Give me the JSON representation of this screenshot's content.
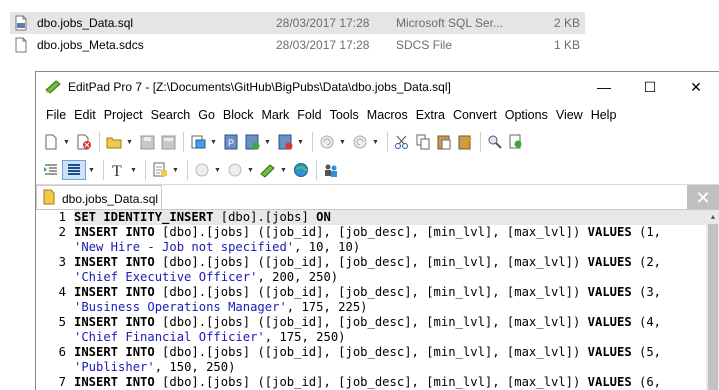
{
  "explorer": {
    "files": [
      {
        "name": "dbo.jobs_Data.sql",
        "date": "28/03/2017 17:28",
        "type": "Microsoft SQL Ser...",
        "size": "2 KB",
        "icon": "sql-file-icon",
        "selected": true
      },
      {
        "name": "dbo.jobs_Meta.sdcs",
        "date": "28/03/2017 17:28",
        "type": "SDCS File",
        "size": "1 KB",
        "icon": "generic-file-icon",
        "selected": false
      }
    ]
  },
  "window": {
    "title": "EditPad Pro 7 - [Z:\\Documents\\GitHub\\BigPubs\\Data\\dbo.jobs_Data.sql]",
    "controls": {
      "minimize": "—",
      "maximize": "☐",
      "close": "✕"
    }
  },
  "menu": [
    "File",
    "Edit",
    "Project",
    "Search",
    "Go",
    "Block",
    "Mark",
    "Fold",
    "Tools",
    "Macros",
    "Extra",
    "Convert",
    "Options",
    "View",
    "Help"
  ],
  "tab": {
    "label": "dbo.jobs_Data.sql",
    "close": "✕"
  },
  "editor": {
    "lines": [
      {
        "n": "1",
        "current": true,
        "parts": [
          [
            "kw",
            "SET IDENTITY_INSERT"
          ],
          [
            "t",
            " [dbo].[jobs] "
          ],
          [
            "kw",
            "ON"
          ]
        ]
      },
      {
        "n": "2",
        "parts": [
          [
            "kw",
            "INSERT INTO"
          ],
          [
            "t",
            " [dbo].[jobs] ([job_id], [job_desc], [min_lvl], [max_lvl]) "
          ],
          [
            "kw",
            "VALUES"
          ],
          [
            "t",
            " (1,"
          ]
        ]
      },
      {
        "n": "",
        "parts": [
          [
            "str",
            "'New Hire - Job not specified'"
          ],
          [
            "t",
            ", 10, 10)"
          ]
        ]
      },
      {
        "n": "3",
        "parts": [
          [
            "kw",
            "INSERT INTO"
          ],
          [
            "t",
            " [dbo].[jobs] ([job_id], [job_desc], [min_lvl], [max_lvl]) "
          ],
          [
            "kw",
            "VALUES"
          ],
          [
            "t",
            " (2,"
          ]
        ]
      },
      {
        "n": "",
        "parts": [
          [
            "str",
            "'Chief Executive Officer'"
          ],
          [
            "t",
            ", 200, 250)"
          ]
        ]
      },
      {
        "n": "4",
        "parts": [
          [
            "kw",
            "INSERT INTO"
          ],
          [
            "t",
            " [dbo].[jobs] ([job_id], [job_desc], [min_lvl], [max_lvl]) "
          ],
          [
            "kw",
            "VALUES"
          ],
          [
            "t",
            " (3,"
          ]
        ]
      },
      {
        "n": "",
        "parts": [
          [
            "str",
            "'Business Operations Manager'"
          ],
          [
            "t",
            ", 175, 225)"
          ]
        ]
      },
      {
        "n": "5",
        "parts": [
          [
            "kw",
            "INSERT INTO"
          ],
          [
            "t",
            " [dbo].[jobs] ([job_id], [job_desc], [min_lvl], [max_lvl]) "
          ],
          [
            "kw",
            "VALUES"
          ],
          [
            "t",
            " (4,"
          ]
        ]
      },
      {
        "n": "",
        "parts": [
          [
            "str",
            "'Chief Financial Officier'"
          ],
          [
            "t",
            ", 175, 250)"
          ]
        ]
      },
      {
        "n": "6",
        "parts": [
          [
            "kw",
            "INSERT INTO"
          ],
          [
            "t",
            " [dbo].[jobs] ([job_id], [job_desc], [min_lvl], [max_lvl]) "
          ],
          [
            "kw",
            "VALUES"
          ],
          [
            "t",
            " (5,"
          ]
        ]
      },
      {
        "n": "",
        "parts": [
          [
            "str",
            "'Publisher'"
          ],
          [
            "t",
            ", 150, 250)"
          ]
        ]
      },
      {
        "n": "7",
        "parts": [
          [
            "kw",
            "INSERT INTO"
          ],
          [
            "t",
            " [dbo].[jobs] ([job_id], [job_desc], [min_lvl], [max_lvl]) "
          ],
          [
            "kw",
            "VALUES"
          ],
          [
            "t",
            " (6,"
          ]
        ]
      }
    ]
  },
  "colors": {
    "keyword": "#000000",
    "string": "#1a1ab8",
    "current_line": "#e8e8e8",
    "tab_close_bg": "#c0c0c0",
    "selection_row": "#e5e5e5"
  }
}
